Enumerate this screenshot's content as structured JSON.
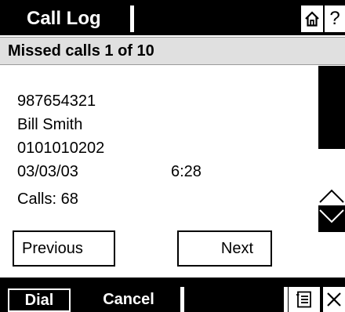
{
  "header": {
    "title": "Call Log",
    "home_icon": "home-icon",
    "help_label": "?"
  },
  "subtitle": "Missed calls 1 of 10",
  "record": {
    "number": "987654321",
    "name": "Bill Smith",
    "code": "0101010202",
    "date": "03/03/03",
    "time": "6:28",
    "calls": "Calls: 68"
  },
  "nav": {
    "previous": "Previous",
    "next": "Next"
  },
  "softkeys": {
    "dial": "Dial",
    "cancel": "Cancel",
    "list_icon": "list-icon",
    "close_icon": "close-icon"
  },
  "colors": {
    "bar": "#000000",
    "subtitle_bg": "#e0e0e0",
    "text": "#000000",
    "background": "#ffffff"
  }
}
